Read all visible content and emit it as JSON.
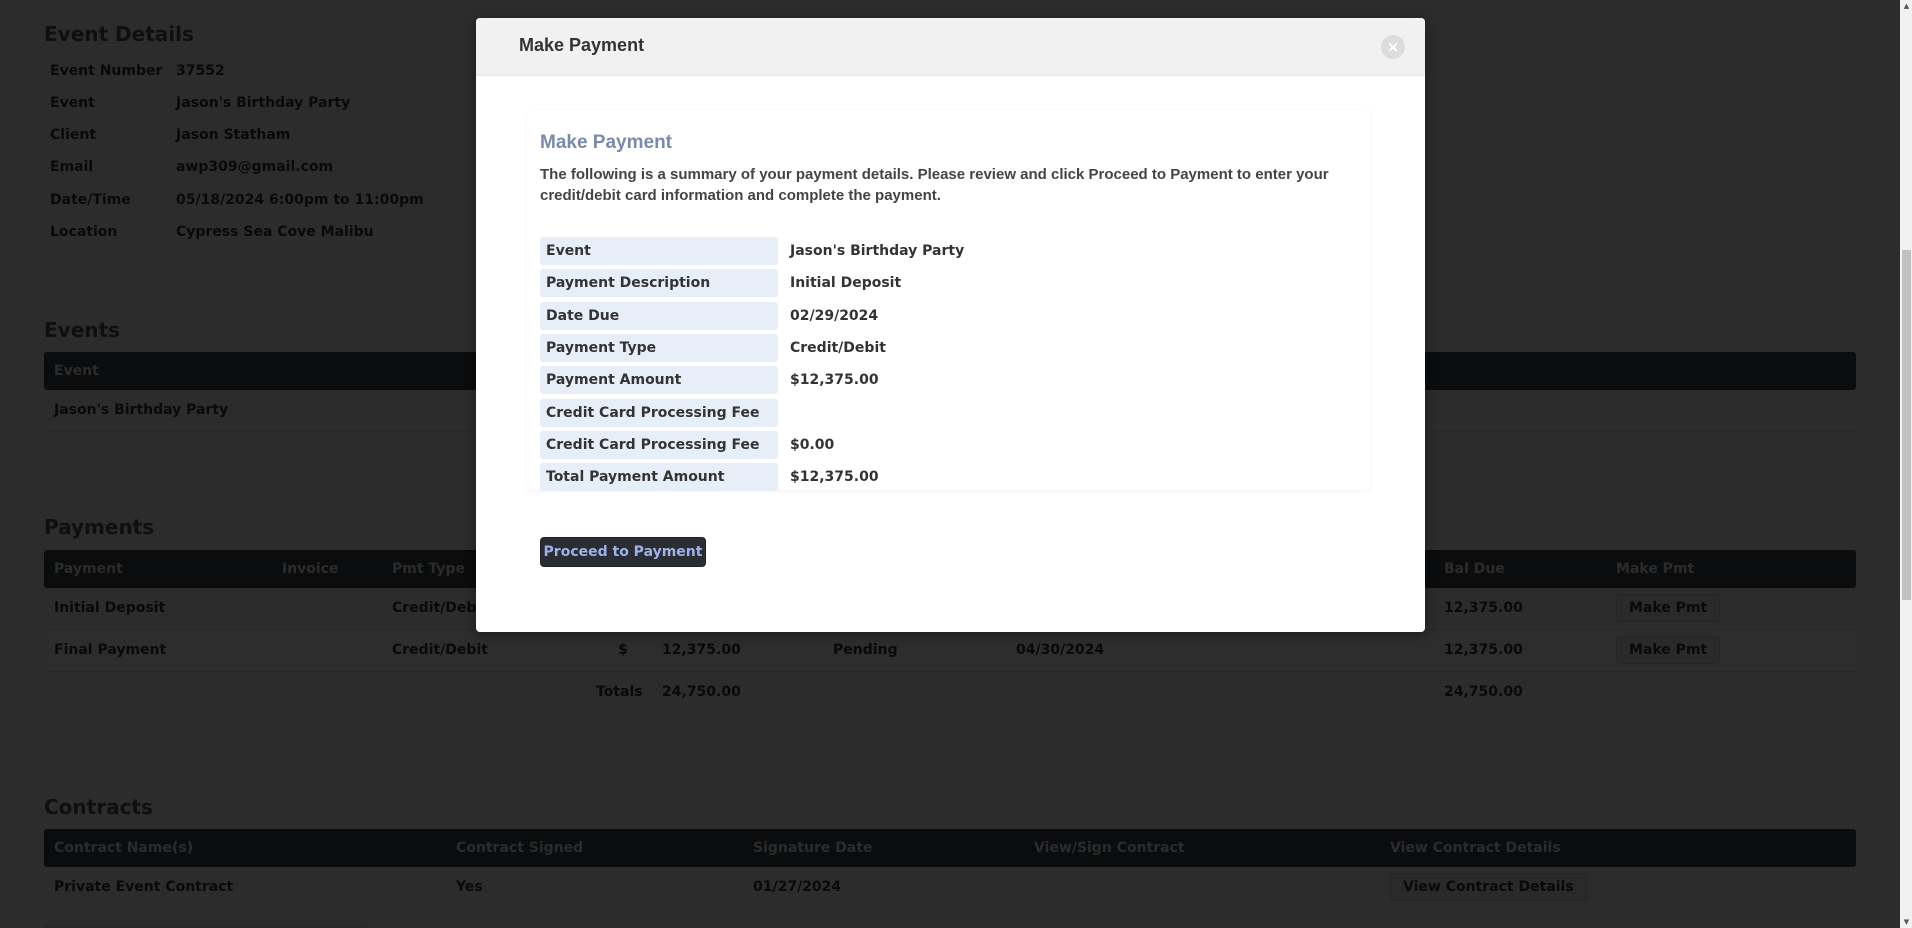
{
  "event_details": {
    "title": "Event Details",
    "rows": [
      {
        "label": "Event Number",
        "value": "37552"
      },
      {
        "label": "Event",
        "value": "Jason's Birthday Party"
      },
      {
        "label": "Client",
        "value": "Jason Statham"
      },
      {
        "label": "Email",
        "value": "awp309@gmail.com"
      },
      {
        "label": "Date/Time",
        "value": "05/18/2024 6:00pm to 11:00pm"
      },
      {
        "label": "Location",
        "value": "Cypress Sea Cove Malibu"
      }
    ]
  },
  "events": {
    "title": "Events",
    "headers": [
      "Event"
    ],
    "rows": [
      [
        "Jason's Birthday Party"
      ]
    ]
  },
  "payments": {
    "title": "Payments",
    "headers": [
      "Payment",
      "Invoice",
      "Pmt Type",
      "Bal Due",
      "Make Pmt"
    ],
    "rows": [
      {
        "payment": "Initial Deposit",
        "pmt_type": "Credit/Debit",
        "bal_due": "12,375.00",
        "action": "Make Pmt"
      },
      {
        "payment": "Final Payment",
        "pmt_type": "Credit/Debit",
        "currency": "$",
        "amount": "12,375.00",
        "status": "Pending",
        "due_date": "04/30/2024",
        "bal_due": "12,375.00",
        "action": "Make Pmt"
      }
    ],
    "totals": {
      "label": "Totals",
      "amount": "24,750.00",
      "bal_due": "24,750.00"
    }
  },
  "contracts": {
    "title": "Contracts",
    "headers": [
      "Contract Name(s)",
      "Contract Signed",
      "Signature Date",
      "View/Sign Contract",
      "View Contract Details"
    ],
    "rows": [
      {
        "name": "Private Event Contract",
        "signed": "Yes",
        "signature_date": "01/27/2024",
        "action": "View Contract Details"
      }
    ]
  },
  "modal": {
    "title": "Make Payment",
    "close_icon": "×",
    "card_title": "Make Payment",
    "description": "The following is a summary of your payment details. Please review and click Proceed to Payment to enter your credit/debit card information and complete the payment.",
    "details": [
      {
        "label": "Event",
        "value": "Jason's Birthday Party"
      },
      {
        "label": "Payment Description",
        "value": "Initial Deposit"
      },
      {
        "label": "Date Due",
        "value": "02/29/2024"
      },
      {
        "label": "Payment Type",
        "value": "Credit/Debit"
      },
      {
        "label": "Payment Amount",
        "value": "$12,375.00"
      },
      {
        "label": "Credit Card Processing Fee %",
        "value": ""
      },
      {
        "label": "Credit Card Processing Fee",
        "value": "$0.00"
      },
      {
        "label": "Total Payment Amount",
        "value": "$12,375.00"
      }
    ],
    "proceed_label": "Proceed to Payment"
  },
  "scrollbar": {
    "up": "▲",
    "down": "▼"
  }
}
